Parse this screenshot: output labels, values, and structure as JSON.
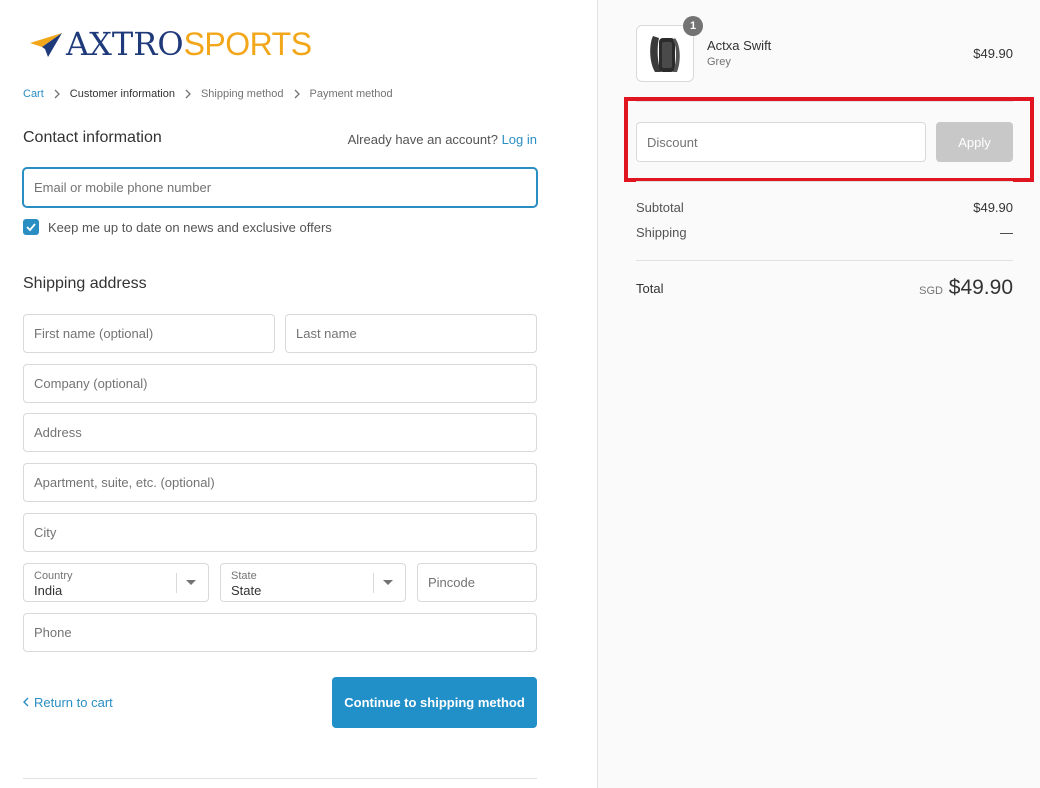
{
  "logo": {
    "part1": "AXTRO",
    "part2": "SPORTS"
  },
  "breadcrumb": {
    "items": [
      {
        "label": "Cart"
      },
      {
        "label": "Customer information"
      },
      {
        "label": "Shipping method"
      },
      {
        "label": "Payment method"
      }
    ]
  },
  "contact": {
    "title": "Contact information",
    "account_prompt": "Already have an account?",
    "login_label": "Log in",
    "email_placeholder": "Email or mobile phone number",
    "newsletter_label": "Keep me up to date on news and exclusive offers",
    "newsletter_checked": true
  },
  "shipping": {
    "title": "Shipping address",
    "first_name_placeholder": "First name (optional)",
    "last_name_placeholder": "Last name",
    "company_placeholder": "Company (optional)",
    "address_placeholder": "Address",
    "apartment_placeholder": "Apartment, suite, etc. (optional)",
    "city_placeholder": "City",
    "country": {
      "label": "Country",
      "value": "India"
    },
    "state": {
      "label": "State",
      "value": "State"
    },
    "pincode_placeholder": "Pincode",
    "phone_placeholder": "Phone"
  },
  "actions": {
    "return_label": "Return to cart",
    "continue_label": "Continue to shipping method"
  },
  "order": {
    "product": {
      "quantity": "1",
      "name": "Actxa Swift",
      "variant": "Grey",
      "price": "$49.90"
    },
    "discount_placeholder": "Discount",
    "apply_label": "Apply",
    "subtotal_label": "Subtotal",
    "subtotal_value": "$49.90",
    "shipping_label": "Shipping",
    "shipping_value": "—",
    "total_label": "Total",
    "total_currency": "SGD",
    "total_value": "$49.90"
  },
  "colors": {
    "accent": "#2190c9",
    "highlight": "#e0151f",
    "logo_blue": "#1f3a7a",
    "logo_orange": "#f2a71b"
  }
}
